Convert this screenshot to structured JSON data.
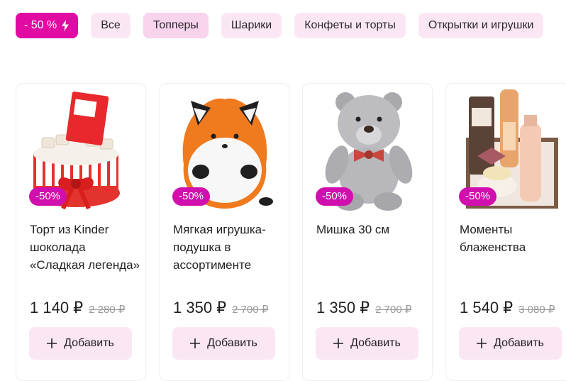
{
  "filters": {
    "sale_label": "- 50 %",
    "items": [
      "Все",
      "Топперы",
      "Шарики",
      "Конфеты и торты",
      "Открытки и игрушки"
    ]
  },
  "colors": {
    "accent": "#e10aa3",
    "chip_bg": "#fbe7f4",
    "badge": "#d10fae"
  },
  "products": [
    {
      "image_icon": "kinder-cake-image",
      "badge": "-50%",
      "title": "Торт из Kinder шоколада «Сладкая легенда»",
      "price": "1 140 ₽",
      "old_price": "2 280 ₽",
      "button": "Добавить"
    },
    {
      "image_icon": "fox-pillow-toy-image",
      "badge": "-50%",
      "title": "Мягкая игрушка-подушка в ассортименте",
      "price": "1 350 ₽",
      "old_price": "2 700 ₽",
      "button": "Добавить"
    },
    {
      "image_icon": "teddy-bear-image",
      "badge": "-50%",
      "title": "Мишка 30 см",
      "price": "1 350 ₽",
      "old_price": "2 700 ₽",
      "button": "Добавить"
    },
    {
      "image_icon": "cosmetics-gift-box-image",
      "badge": "-50%",
      "title": "Моменты блаженства",
      "price": "1 540 ₽",
      "old_price": "3 080 ₽",
      "button": "Добавить"
    }
  ]
}
